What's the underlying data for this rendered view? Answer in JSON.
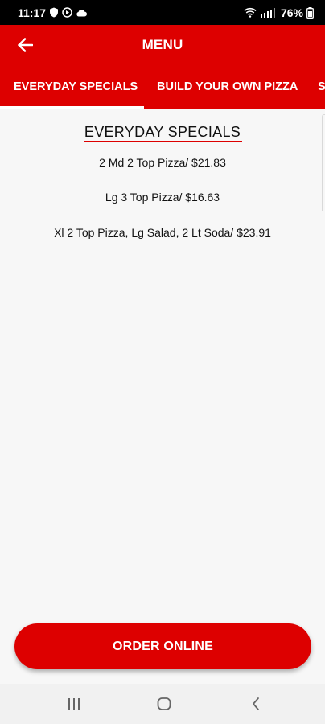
{
  "status_bar": {
    "time": "11:17",
    "battery": "76%"
  },
  "app_bar": {
    "title": "MENU"
  },
  "tabs": [
    {
      "label": "EVERYDAY SPECIALS",
      "selected": true
    },
    {
      "label": "BUILD YOUR OWN PIZZA",
      "selected": false
    },
    {
      "label": "S",
      "selected": false
    }
  ],
  "section": {
    "title": "EVERYDAY SPECIALS",
    "items": [
      "2 Md 2 Top Pizza/ $21.83",
      "Lg 3 Top Pizza/ $16.63",
      "Xl 2 Top Pizza, Lg Salad, 2 Lt Soda/ $23.91"
    ]
  },
  "order_button": {
    "label": "ORDER ONLINE"
  },
  "colors": {
    "brand_red": "#dd0000",
    "background": "#f7f7f7"
  },
  "icons": {
    "back": "arrow-left-icon",
    "nav_recents": "recents-icon",
    "nav_home": "home-icon",
    "nav_back": "chevron-left-icon"
  }
}
